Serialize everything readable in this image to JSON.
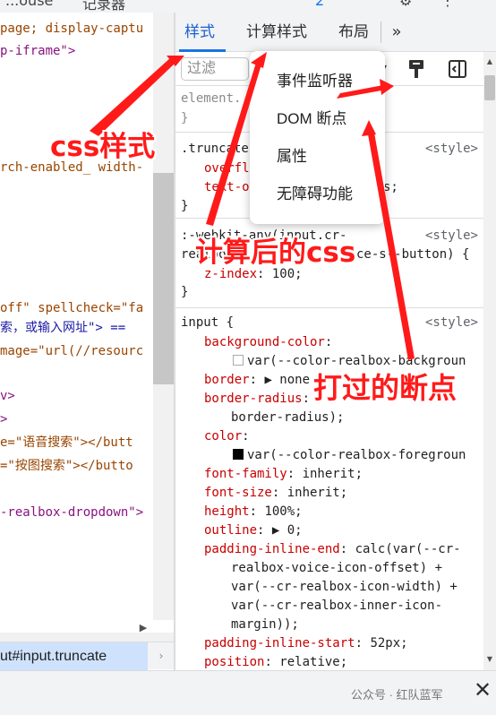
{
  "topbar": {
    "fragment_left": "...ouse",
    "fragment_mid": "记录器",
    "badge": "2"
  },
  "elements": {
    "lines": [
      {
        "id": "l1",
        "text": "page; display-captu"
      },
      {
        "id": "l2",
        "text": "p-iframe\">"
      },
      {
        "id": "l3",
        "text": "rch-enabled_ width-"
      },
      {
        "id": "l4a",
        "text": "off\" spellcheck=\"fa"
      },
      {
        "id": "l5",
        "text": "索，或输入网址\"> =="
      },
      {
        "id": "l6",
        "text": "mage=\"url(//resourc"
      },
      {
        "id": "l7",
        "text": "v>"
      },
      {
        "id": "l8",
        "text": ">"
      },
      {
        "id": "l9",
        "text": "e=\"语音搜索\"></butt"
      },
      {
        "id": "l10",
        "text": "=\"按图搜索\"></butto"
      },
      {
        "id": "l11",
        "text": "-realbox-dropdown\">"
      }
    ]
  },
  "breadcrumb": {
    "current": "ut#input.truncate",
    "next": "›"
  },
  "tabs": {
    "styles": "样式",
    "computed": "计算样式",
    "layout": "布局",
    "more": "»"
  },
  "filter": {
    "placeholder": "过滤"
  },
  "styles": {
    "element_selector": "element.",
    "element_close": "}",
    "truncate_selector": ".truncate",
    "truncate_src": "<style>",
    "truncate_p1": "overfl",
    "truncate_p2": "text-o",
    "truncate_p2_tail": "s;",
    "truncate_close": "}",
    "webkit_selector_1": ":-webkit-any(input.cr-",
    "webkit_selector_2": "realbox-i",
    "webkit_selector_2_tail": "ce-s--button) {",
    "webkit_src": "<style>",
    "webkit_prop": "z-index",
    "webkit_val": "100;",
    "webkit_close": "}",
    "input_selector": "input {",
    "input_src": "<style>",
    "props": [
      {
        "name": "background-color",
        "value": "var(--color-realbox-backgroun"
      },
      {
        "name": "border",
        "value": "▶ none"
      },
      {
        "name": "border-radius",
        "value": ""
      },
      {
        "name": "",
        "value": "border-radius);"
      },
      {
        "name": "color",
        "value": "var(--color-realbox-foregroun"
      },
      {
        "name": "font-family",
        "value": "inherit;"
      },
      {
        "name": "font-size",
        "value": "inherit;"
      },
      {
        "name": "height",
        "value": "100%;"
      },
      {
        "name": "outline",
        "value": "▶ 0;"
      },
      {
        "name": "padding-inline-end",
        "value": "calc(var(--cr-"
      },
      {
        "name": "",
        "value": "realbox-voice-icon-offset) +"
      },
      {
        "name": "",
        "value": "var(--cr-realbox-icon-width) +"
      },
      {
        "name": "",
        "value": "var(--cr-realbox-inner-icon-"
      },
      {
        "name": "",
        "value": "margin));"
      },
      {
        "name": "padding-inline-start",
        "value": "52px;"
      },
      {
        "name": "position",
        "value": "relative;"
      }
    ]
  },
  "menu": {
    "items": [
      "事件监听器",
      "DOM 断点",
      "属性",
      "无障碍功能"
    ]
  },
  "annotations": {
    "css_styles": "css样式",
    "computed_css": "计算后的css",
    "breakpoints": "打过的断点"
  },
  "colors": {
    "annotation": "#ff1a1a",
    "tab_active": "#1a73e8",
    "breadcrumb_bg": "#cfe2fd",
    "background_swatch": "#ffffff",
    "color_swatch": "#000000"
  },
  "watermark": "公众号 · 红队蓝军",
  "close_label": "✕"
}
